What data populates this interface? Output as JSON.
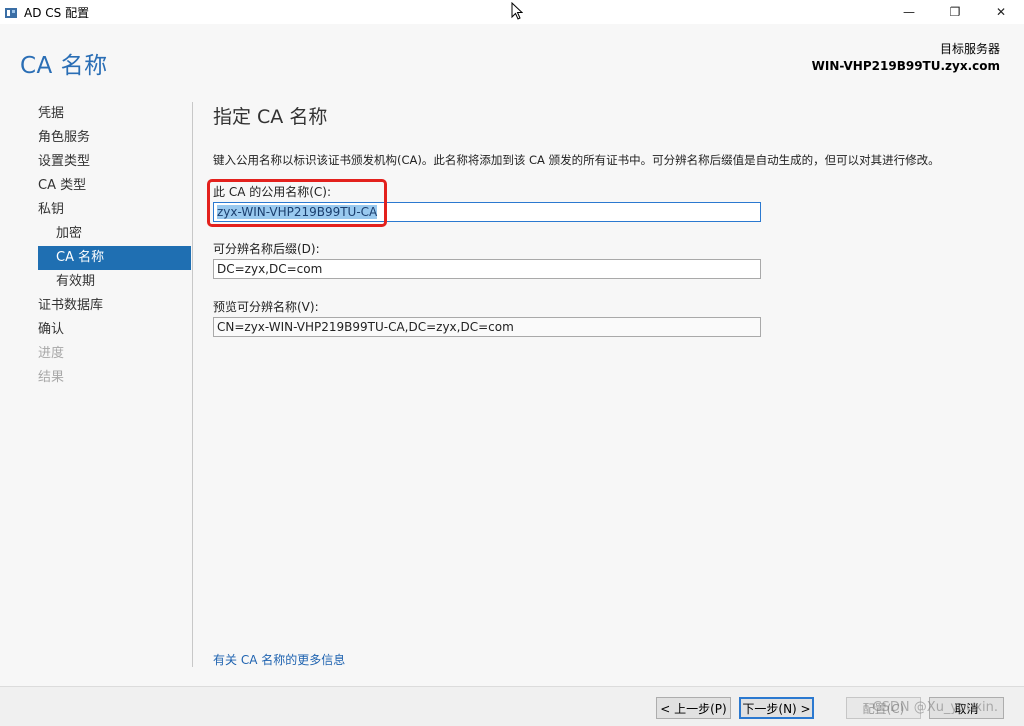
{
  "window": {
    "title": "AD CS 配置",
    "minimize": "—",
    "maximize": "❐",
    "close": "✕"
  },
  "header": {
    "page_title": "CA 名称",
    "target_label": "目标服务器",
    "target_server": "WIN-VHP219B99TU.zyx.com"
  },
  "sidebar": {
    "items": [
      {
        "label": "凭据"
      },
      {
        "label": "角色服务"
      },
      {
        "label": "设置类型"
      },
      {
        "label": "CA 类型"
      },
      {
        "label": "私钥"
      },
      {
        "label": "加密"
      },
      {
        "label": "CA 名称"
      },
      {
        "label": "有效期"
      },
      {
        "label": "证书数据库"
      },
      {
        "label": "确认"
      },
      {
        "label": "进度"
      },
      {
        "label": "结果"
      }
    ]
  },
  "main": {
    "section_title": "指定 CA 名称",
    "description": "键入公用名称以标识该证书颁发机构(CA)。此名称将添加到该 CA 颁发的所有证书中。可分辨名称后缀值是自动生成的，但可以对其进行修改。",
    "common_name_label": "此 CA 的公用名称(C):",
    "common_name_value": "zyx-WIN-VHP219B99TU-CA",
    "dn_suffix_label": "可分辨名称后缀(D):",
    "dn_suffix_value": "DC=zyx,DC=com",
    "preview_label": "预览可分辨名称(V):",
    "preview_value": "CN=zyx-WIN-VHP219B99TU-CA,DC=zyx,DC=com",
    "more_info_link": "有关 CA 名称的更多信息"
  },
  "footer": {
    "back_label": "< 上一步(P)",
    "next_label": "下一步(N) >",
    "configure_label": "配置(C)",
    "cancel_label": "取消",
    "watermark": "CSDN @Xu_youxin."
  },
  "colors": {
    "accent": "#1f6fb2",
    "title_blue": "#2a6eb5",
    "highlight_red": "#e3211d",
    "selection": "#99c9ef"
  }
}
